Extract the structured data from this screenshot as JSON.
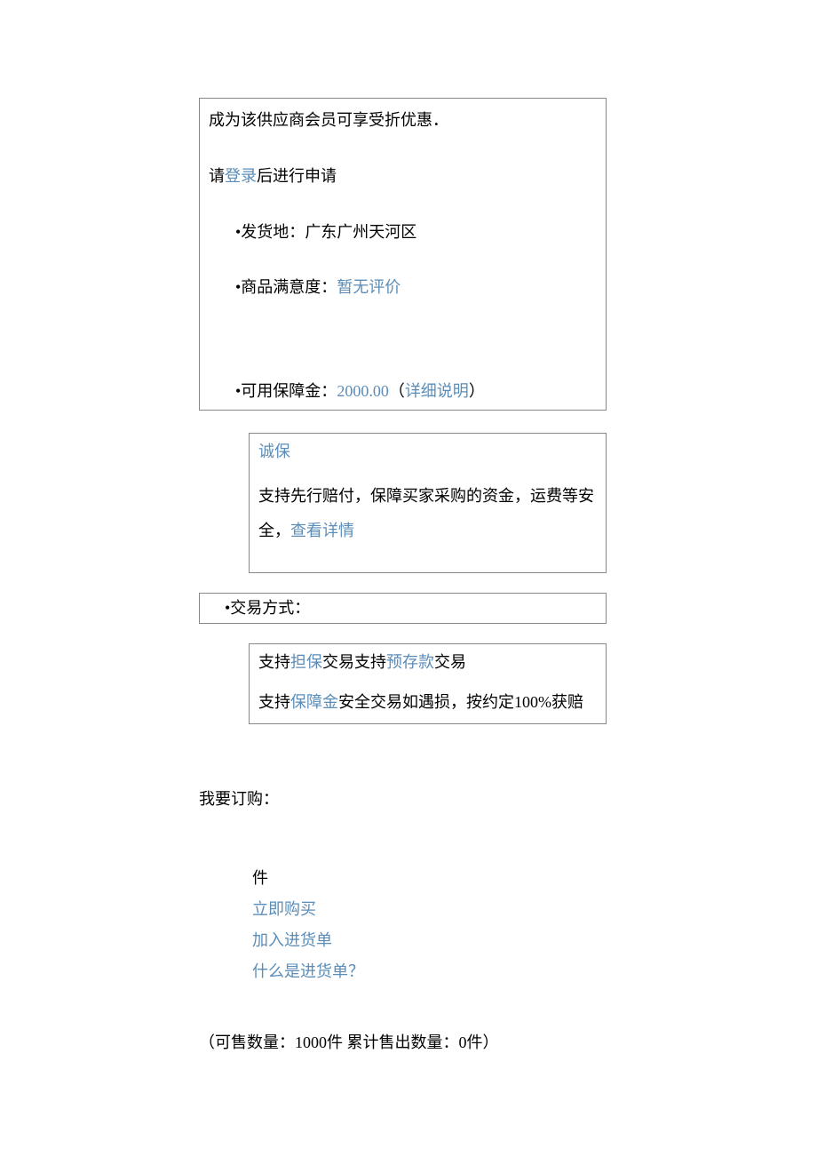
{
  "box1": {
    "line1": "成为该供应商会员可享受折优惠．",
    "line2_pre": "请",
    "line2_link": "登录",
    "line2_post": "后进行申请",
    "ship_label": "•发货地：",
    "ship_value": "广东广州天河区",
    "sat_label": "•商品满意度：",
    "sat_value": "暂无评价",
    "deposit_label": "•可用保障金：",
    "deposit_value": "2000.00",
    "deposit_paren_open": "（",
    "deposit_link": "详细说明",
    "deposit_paren_close": "）"
  },
  "box2": {
    "title": "诚保",
    "desc_pre": "支持先行赔付，保障买家采购的资金，运费等安全，",
    "desc_link": "查看详情"
  },
  "box3": {
    "label": "•交易方式："
  },
  "box4": {
    "line1_pre": "支持",
    "line1_link1": "担保",
    "line1_mid": "交易支持",
    "line1_link2": "预存款",
    "line1_post": "交易",
    "line2_pre": "支持",
    "line2_link": "保障金",
    "line2_post": "安全交易如遇损，按约定100%获赔"
  },
  "order": {
    "title": "我要订购：",
    "unit": "件",
    "buy_now": "立即购买",
    "add_cart": "加入进货单",
    "what_is": "什么是进货单？"
  },
  "stock": {
    "text": "（可售数量：1000件  累计售出数量：0件）"
  }
}
